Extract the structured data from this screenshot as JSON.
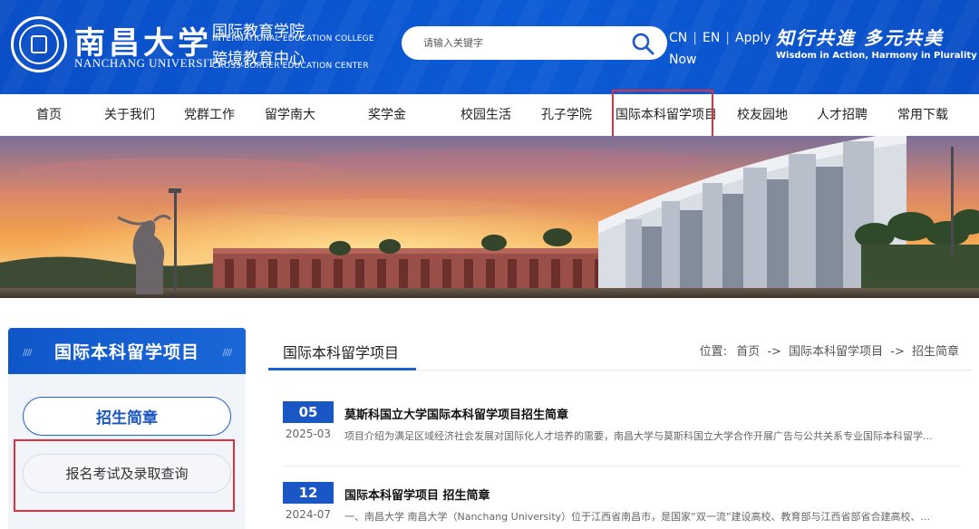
{
  "header": {
    "university_cn": "南昌大学",
    "university_en": "NANCHANG UNIVERSITY",
    "college_cn": "国际教育学院",
    "college_en": "INTERNATIONAL EDUCATION COLLEGE",
    "center_cn": "跨境教育中心",
    "center_en": "CROSS-BORDER EDUCATION CENTER",
    "search_placeholder": "请输入关键字",
    "lang_cn": "CN",
    "lang_en": "EN",
    "apply_line1": "Apply",
    "apply_line2": "Now",
    "motto_cn": "知行共進 多元共美",
    "motto_en": "Wisdom in Action, Harmony in Plurality"
  },
  "nav": {
    "items": [
      "首页",
      "关于我们",
      "党群工作",
      "留学南大",
      "奖学金",
      "校园生活",
      "孔子学院",
      "国际本科留学项目",
      "校友园地",
      "人才招聘",
      "常用下载"
    ]
  },
  "sidebar": {
    "title": "国际本科留学项目",
    "items": [
      "招生简章",
      "报名考试及录取查询"
    ]
  },
  "main": {
    "title": "国际本科留学项目",
    "breadcrumb": {
      "label": "位置:",
      "home": "首页",
      "arrow": "->",
      "section": "国际本科留学项目",
      "current": "招生简章"
    },
    "news": [
      {
        "day": "05",
        "ym": "2025-03",
        "title": "莫斯科国立大学国际本科留学项目招生简章",
        "summary": "项目介绍为满足区域经济社会发展对国际化人才培养的需要，南昌大学与莫斯科国立大学合作开展广告与公共关系专业国际本科留学..."
      },
      {
        "day": "12",
        "ym": "2024-07",
        "title": "国际本科留学项目 招生简章",
        "summary": "一、南昌大学 南昌大学（Nanchang University）位于江西省南昌市，是国家“双一流”建设高校、教育部与江西省部省合建高校、..."
      }
    ]
  },
  "colors": {
    "brand_blue": "#0c55d0",
    "highlight_red": "#e0303b"
  }
}
